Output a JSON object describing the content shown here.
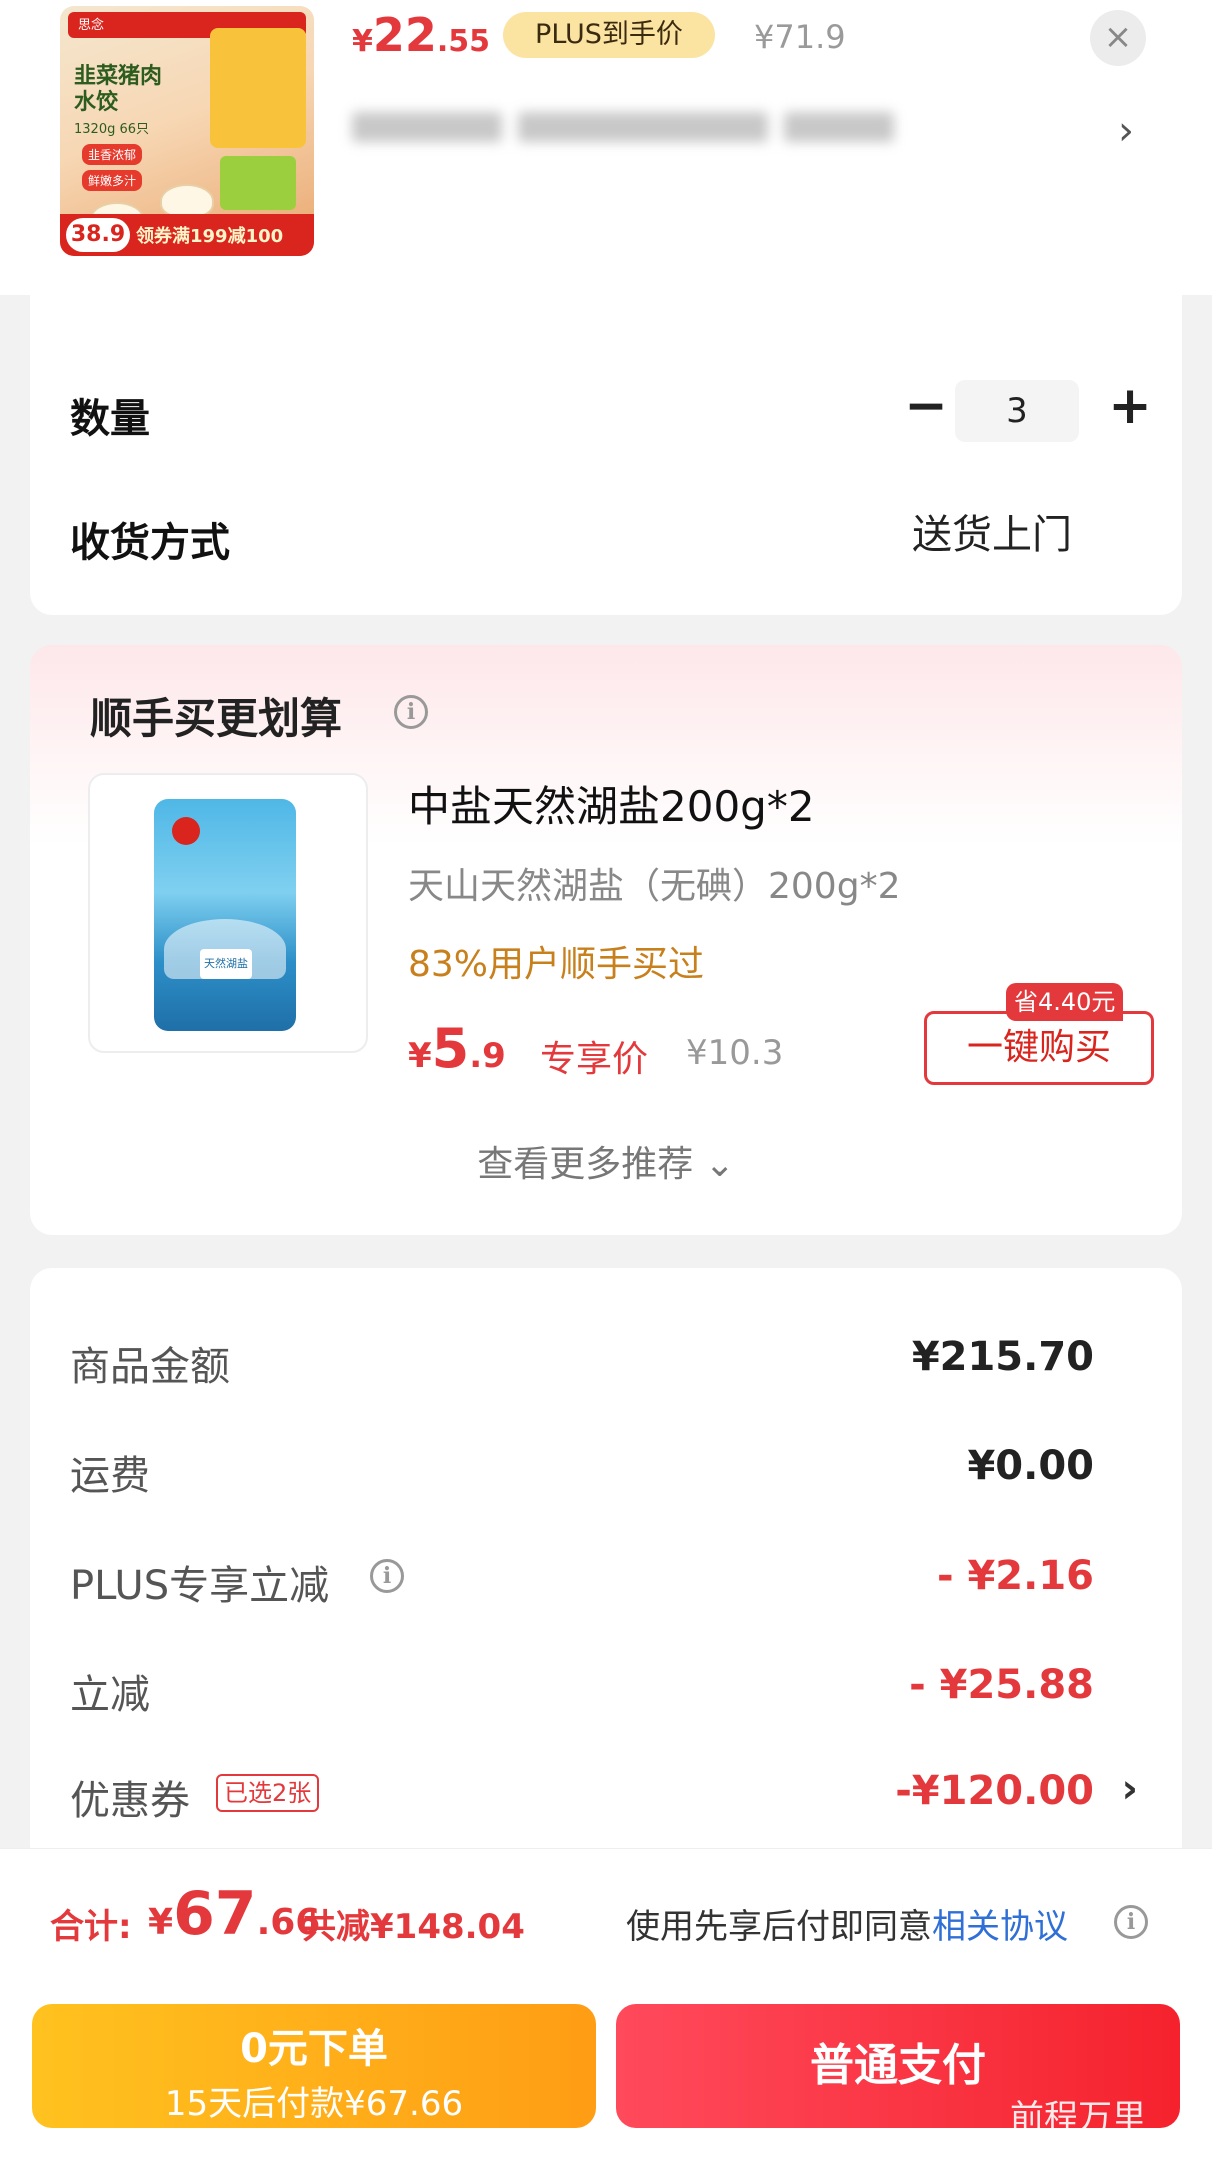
{
  "product": {
    "image": {
      "brand": "思念",
      "dish": "韭菜猪肉水饺",
      "spec": "1320g 66只",
      "tag1": "韭香浓郁",
      "tag2": "鲜嫩多汁",
      "price_badge": "38.9",
      "coupon": "领券满199减100"
    },
    "price_yen": "¥",
    "price_int": "22",
    "price_dec": ".55",
    "plus_label": "PLUS到手价",
    "orig_price": "¥71.9",
    "close_icon": "×",
    "spec_chevron": "›"
  },
  "quantity": {
    "label": "数量",
    "minus": "−",
    "value": "3",
    "plus": "+"
  },
  "delivery": {
    "label": "收货方式",
    "value": "送货上门"
  },
  "recommend": {
    "title": "顺手买更划算",
    "info_icon": "i",
    "item": {
      "name": "中盐天然湖盐200g*2",
      "subtitle": "天山天然湖盐（无碘）200g*2",
      "bought": "83%用户顺手买过",
      "price_yen": "¥",
      "price_int": "5",
      "price_dec": ".9",
      "price_note": "专享价",
      "orig_price": "¥10.3",
      "save_tag": "省4.40元",
      "buy_label": "一键购买",
      "bag_label": "天然湖盐"
    },
    "more": "查看更多推荐 ⌄"
  },
  "summary": {
    "rows": [
      {
        "label": "商品金额",
        "value": "¥215.70"
      },
      {
        "label": "运费",
        "value": "¥0.00"
      },
      {
        "label": "PLUS专享立减",
        "value": "- ¥2.16"
      },
      {
        "label": "立减",
        "value": "- ¥25.88"
      },
      {
        "label": "优惠券",
        "value": "-¥120.00",
        "chip": "已选2张",
        "chevron": "›"
      }
    ],
    "info_icon": "i"
  },
  "footer": {
    "total_label": "合计:",
    "total_yen": "¥",
    "total_int": "67",
    "total_dec": ".66",
    "saved": "共减¥148.04",
    "agree_prefix": "使用先享后付即同意",
    "agree_link": "相关协议",
    "info_icon": "i",
    "later_main": "0元下单",
    "later_sub": "15天后付款¥67.66",
    "pay_label": "普通支付",
    "watermark": "前程万里"
  },
  "colors": {
    "accent_red": "#e4393c",
    "plus_gold": "#fbe3a2",
    "later_yellow": "#ffb21a",
    "link_blue": "#2f6fd6"
  }
}
